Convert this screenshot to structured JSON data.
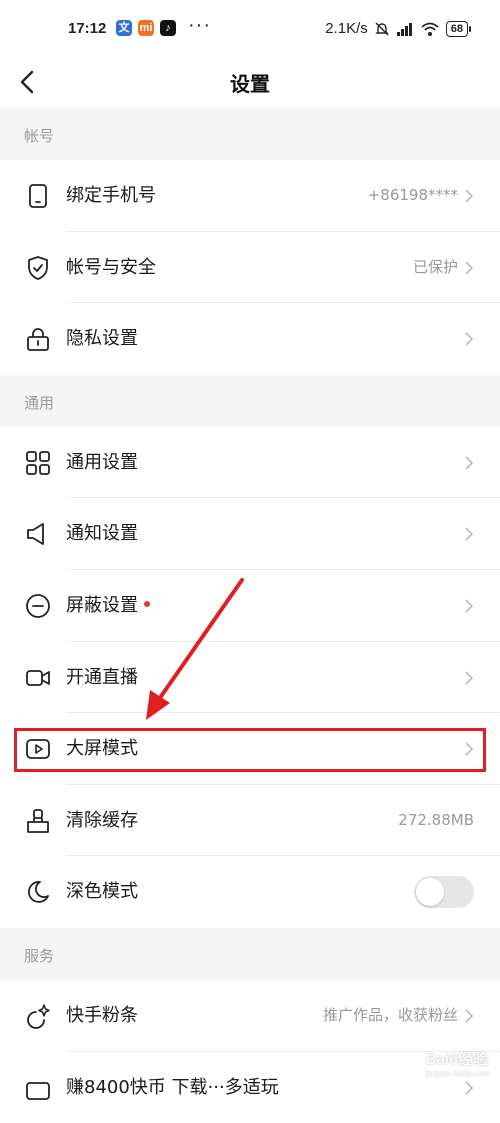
{
  "status_bar": {
    "time": "17:12",
    "network_speed": "2.1K/s",
    "battery": "68",
    "more": "···"
  },
  "nav": {
    "title": "设置"
  },
  "sections": {
    "account": {
      "header": "帐号",
      "items": [
        {
          "label": "绑定手机号",
          "value": "+86198****",
          "icon": "phone-icon"
        },
        {
          "label": "帐号与安全",
          "value": "已保护",
          "icon": "shield-icon"
        },
        {
          "label": "隐私设置",
          "value": "",
          "icon": "lock-icon"
        }
      ]
    },
    "general": {
      "header": "通用",
      "items": [
        {
          "label": "通用设置",
          "value": "",
          "icon": "grid-icon"
        },
        {
          "label": "通知设置",
          "value": "",
          "icon": "speaker-icon"
        },
        {
          "label": "屏蔽设置",
          "value": "",
          "icon": "block-icon",
          "badge": "red-dot"
        },
        {
          "label": "开通直播",
          "value": "",
          "icon": "camera-icon"
        },
        {
          "label": "大屏模式",
          "value": "",
          "icon": "tv-play-icon"
        },
        {
          "label": "清除缓存",
          "value": "272.88MB",
          "icon": "broom-icon"
        },
        {
          "label": "深色模式",
          "value": "",
          "icon": "moon-icon",
          "toggle": false
        }
      ]
    },
    "services": {
      "header": "服务",
      "items": [
        {
          "label": "快手粉条",
          "value": "推广作品，收获粉丝",
          "icon": "sparkle-icon"
        },
        {
          "label": "赚8400快币 下载···多适玩",
          "value": "",
          "icon": "gift-icon"
        }
      ]
    }
  },
  "watermark": {
    "brand": "Baiб经验",
    "url": "jingyan.baidu.com"
  },
  "colors": {
    "highlight": "#e02020",
    "background": "#f5f5f5",
    "badge": "#e53935"
  }
}
